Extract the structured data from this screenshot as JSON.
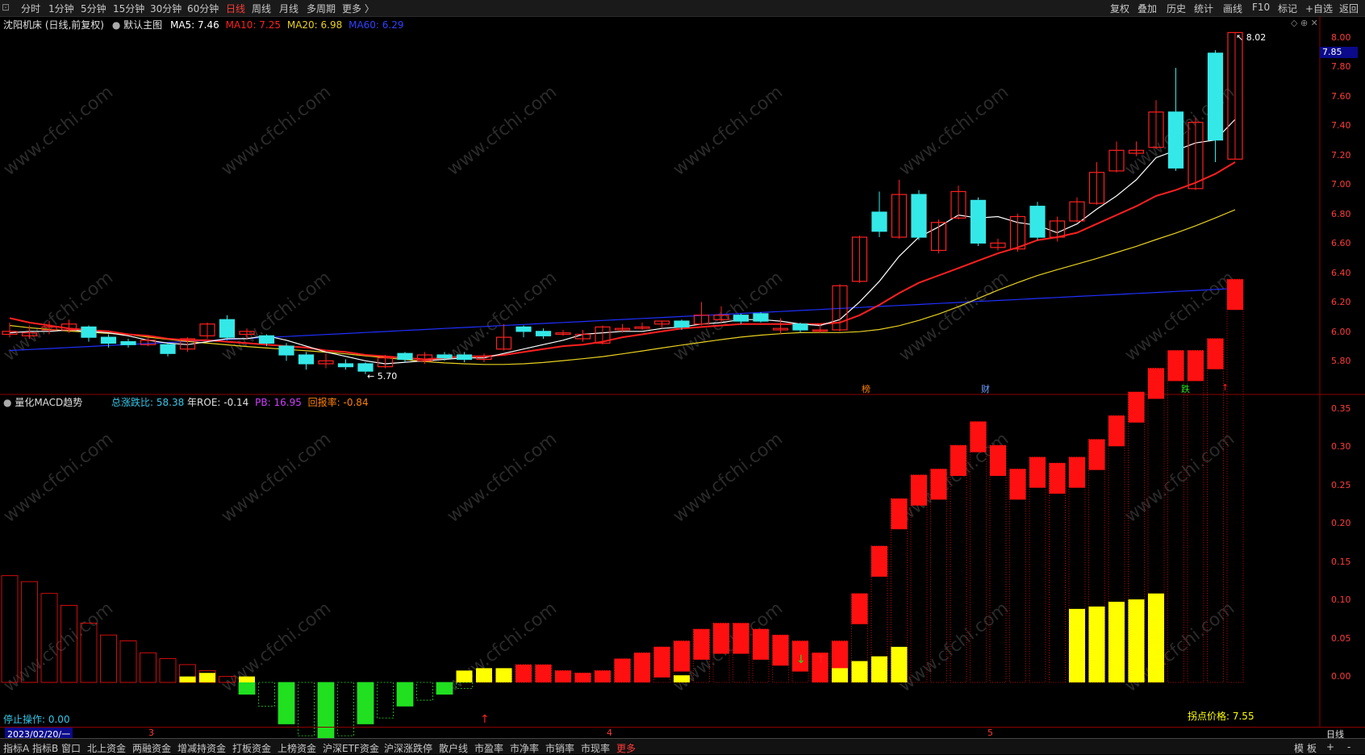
{
  "toolbar": {
    "periods": [
      "分时",
      "1分钟",
      "5分钟",
      "15分钟",
      "30分钟",
      "60分钟",
      "日线",
      "周线",
      "月线",
      "多周期",
      "更多 〉"
    ],
    "active_period": "日线",
    "right_buttons": [
      "复权",
      "叠加",
      "历史",
      "统计",
      "画线",
      "F10",
      "标记",
      "+自选",
      "返回"
    ]
  },
  "main_panel": {
    "title": "沈阳机床 (日线,前复权)",
    "template": "默认主图",
    "ma5": "MA5: 7.46",
    "ma10": "MA10: 7.25",
    "ma20": "MA20: 6.98",
    "ma60": "MA60: 6.29",
    "high_marker": "8.02",
    "low_marker": "5.70",
    "current_price": "7.85",
    "event_labels": [
      "榜",
      "财",
      "跌",
      "↑"
    ]
  },
  "sub_panel": {
    "title": "量化MACD趋势",
    "total_ratio": "总涨跌比: 58.38",
    "roe": "年ROE: -0.14",
    "pb": "PB: 16.95",
    "retracement": "回报率: -0.84",
    "stop_label": "停止操作: 0.00",
    "inflection_label": "拐点价格: 7.55"
  },
  "axis": {
    "price_ticks": [
      "8.00",
      "7.80",
      "7.60",
      "7.40",
      "7.20",
      "7.00",
      "6.80",
      "6.60",
      "6.40",
      "6.20",
      "6.00",
      "5.80"
    ],
    "macd_ticks": [
      "0.35",
      "0.30",
      "0.25",
      "0.20",
      "0.15",
      "0.10",
      "0.05",
      "0.00"
    ],
    "date_cursor": "2023/02/20/一",
    "month_labels": [
      "3",
      "4",
      "5"
    ],
    "period_label": "日线"
  },
  "bottom_tabs": [
    "指标A",
    "指标B",
    "窗口",
    "北上资金",
    "两融资金",
    "增减持资金",
    "打板资金",
    "上榜资金",
    "沪深ETF资金",
    "沪深涨跌停",
    "散户线",
    "市盈率",
    "市净率",
    "市销率",
    "市现率",
    "更多"
  ],
  "bottom_right": [
    "模",
    "板",
    "+",
    "-"
  ],
  "watermark": "www.cfchi.com",
  "colors": {
    "up": "#ff2020",
    "down": "#35e8e8",
    "ma5": "#ffffff",
    "ma10": "#ff2020",
    "ma20": "#e8d020",
    "ma60": "#2030ff",
    "macd_pos": "#ff1010",
    "macd_neg": "#20e020",
    "yellow": "#ffff00"
  },
  "chart_data": {
    "type": "candlestick",
    "candles": [
      [
        5.97,
        5.99,
        5.95,
        6.05
      ],
      [
        5.96,
        5.98,
        5.94,
        6.03
      ],
      [
        6.0,
        6.02,
        5.97,
        6.06
      ],
      [
        6.0,
        6.04,
        5.98,
        6.07
      ],
      [
        6.02,
        5.95,
        5.92,
        6.03
      ],
      [
        5.95,
        5.91,
        5.88,
        5.97
      ],
      [
        5.92,
        5.9,
        5.88,
        5.94
      ],
      [
        5.9,
        5.93,
        5.89,
        5.95
      ],
      [
        5.9,
        5.84,
        5.82,
        5.91
      ],
      [
        5.87,
        5.94,
        5.85,
        5.95
      ],
      [
        5.96,
        6.04,
        5.94,
        6.05
      ],
      [
        6.07,
        5.95,
        5.93,
        6.1
      ],
      [
        5.97,
        5.99,
        5.94,
        6.01
      ],
      [
        5.96,
        5.91,
        5.89,
        5.97
      ],
      [
        5.89,
        5.83,
        5.79,
        5.91
      ],
      [
        5.83,
        5.77,
        5.73,
        5.85
      ],
      [
        5.77,
        5.79,
        5.74,
        5.84
      ],
      [
        5.77,
        5.75,
        5.73,
        5.8
      ],
      [
        5.77,
        5.72,
        5.7,
        5.78
      ],
      [
        5.75,
        5.81,
        5.74,
        5.83
      ],
      [
        5.84,
        5.8,
        5.78,
        5.85
      ],
      [
        5.79,
        5.83,
        5.77,
        5.85
      ],
      [
        5.83,
        5.81,
        5.79,
        5.85
      ],
      [
        5.83,
        5.8,
        5.78,
        5.85
      ],
      [
        5.8,
        5.82,
        5.78,
        5.84
      ],
      [
        5.87,
        5.95,
        5.86,
        6.04
      ],
      [
        6.02,
        5.99,
        5.95,
        6.03
      ],
      [
        5.99,
        5.96,
        5.94,
        6.01
      ],
      [
        5.97,
        5.98,
        5.96,
        6.0
      ],
      [
        5.94,
        5.97,
        5.92,
        6.0
      ],
      [
        5.91,
        6.02,
        5.9,
        6.03
      ],
      [
        6.0,
        6.01,
        5.98,
        6.04
      ],
      [
        6.01,
        6.02,
        6.0,
        6.05
      ],
      [
        6.04,
        6.06,
        6.01,
        6.06
      ],
      [
        6.06,
        6.02,
        6.0,
        6.07
      ],
      [
        6.04,
        6.1,
        6.03,
        6.19
      ],
      [
        6.07,
        6.1,
        6.05,
        6.16
      ],
      [
        6.1,
        6.06,
        6.04,
        6.11
      ],
      [
        6.11,
        6.06,
        6.05,
        6.12
      ],
      [
        6.0,
        6.01,
        5.97,
        6.08
      ],
      [
        6.04,
        6.0,
        5.98,
        6.05
      ],
      [
        6.0,
        6.0,
        5.98,
        6.04
      ],
      [
        6.0,
        6.3,
        5.99,
        6.31
      ],
      [
        6.33,
        6.63,
        6.32,
        6.64
      ],
      [
        6.8,
        6.67,
        6.63,
        6.94
      ],
      [
        6.63,
        6.92,
        6.62,
        7.02
      ],
      [
        6.92,
        6.63,
        6.61,
        6.95
      ],
      [
        6.54,
        6.73,
        6.52,
        6.75
      ],
      [
        6.76,
        6.94,
        6.75,
        6.98
      ],
      [
        6.88,
        6.59,
        6.57,
        6.9
      ],
      [
        6.56,
        6.59,
        6.54,
        6.62
      ],
      [
        6.55,
        6.77,
        6.53,
        6.79
      ],
      [
        6.84,
        6.63,
        6.61,
        6.87
      ],
      [
        6.63,
        6.74,
        6.6,
        6.77
      ],
      [
        6.74,
        6.87,
        6.73,
        6.9
      ],
      [
        6.86,
        7.07,
        6.85,
        7.14
      ],
      [
        7.08,
        7.22,
        7.07,
        7.28
      ],
      [
        7.2,
        7.22,
        7.18,
        7.28
      ],
      [
        7.24,
        7.48,
        7.23,
        7.56
      ],
      [
        7.48,
        7.1,
        7.08,
        7.78
      ],
      [
        6.96,
        7.41,
        6.95,
        7.44
      ],
      [
        7.88,
        7.29,
        7.14,
        7.9
      ],
      [
        7.16,
        8.02,
        7.16,
        8.02
      ]
    ],
    "ma5": [
      5.98,
      5.99,
      5.99,
      6.0,
      5.99,
      5.98,
      5.96,
      5.93,
      5.91,
      5.9,
      5.92,
      5.94,
      5.94,
      5.96,
      5.93,
      5.89,
      5.85,
      5.82,
      5.79,
      5.77,
      5.78,
      5.79,
      5.8,
      5.81,
      5.81,
      5.84,
      5.87,
      5.9,
      5.93,
      5.97,
      5.98,
      5.99,
      5.99,
      6.01,
      6.02,
      6.04,
      6.05,
      6.07,
      6.07,
      6.06,
      6.04,
      6.03,
      6.07,
      6.19,
      6.33,
      6.5,
      6.63,
      6.7,
      6.78,
      6.76,
      6.77,
      6.73,
      6.71,
      6.66,
      6.72,
      6.82,
      6.91,
      7.02,
      7.17,
      7.22,
      7.27,
      7.29,
      7.43
    ],
    "ma10": [
      6.08,
      6.05,
      6.03,
      6.01,
      6.0,
      5.99,
      5.97,
      5.96,
      5.94,
      5.93,
      5.93,
      5.92,
      5.91,
      5.9,
      5.89,
      5.88,
      5.86,
      5.85,
      5.83,
      5.82,
      5.81,
      5.8,
      5.81,
      5.82,
      5.82,
      5.83,
      5.85,
      5.87,
      5.89,
      5.9,
      5.92,
      5.95,
      5.97,
      5.99,
      6.01,
      6.02,
      6.03,
      6.04,
      6.04,
      6.04,
      6.04,
      6.04,
      6.05,
      6.1,
      6.17,
      6.25,
      6.32,
      6.37,
      6.42,
      6.47,
      6.52,
      6.56,
      6.61,
      6.63,
      6.66,
      6.72,
      6.78,
      6.84,
      6.91,
      6.95,
      7.0,
      7.06,
      7.14
    ]
  }
}
